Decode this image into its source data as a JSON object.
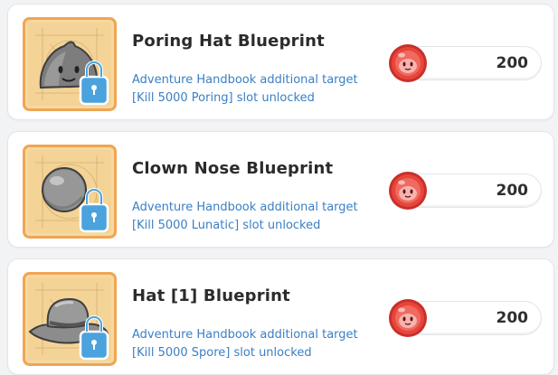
{
  "items": [
    {
      "title": "Poring Hat Blueprint",
      "desc_line1": "Adventure Handbook additional target",
      "desc_line2": "[Kill 5000 Poring] slot unlocked",
      "price": "200",
      "item_icon": "poring-hat-icon"
    },
    {
      "title": "Clown Nose Blueprint",
      "desc_line1": "Adventure Handbook additional target",
      "desc_line2": "[Kill 5000 Lunatic] slot unlocked",
      "price": "200",
      "item_icon": "clown-nose-icon"
    },
    {
      "title": "Hat [1] Blueprint",
      "desc_line1": "Adventure Handbook additional target",
      "desc_line2": "[Kill 5000 Spore] slot unlocked",
      "price": "200",
      "item_icon": "hat-icon"
    }
  ],
  "colors": {
    "title": "#2b2b2b",
    "description": "#3a7fc4",
    "thumb_border": "#f0a552",
    "thumb_fill": "#f6d9a2",
    "lock": "#4aa3dd",
    "coin": "#e8453c"
  },
  "currency_icon": "poring-coin-icon",
  "lock_icon": "lock-icon"
}
